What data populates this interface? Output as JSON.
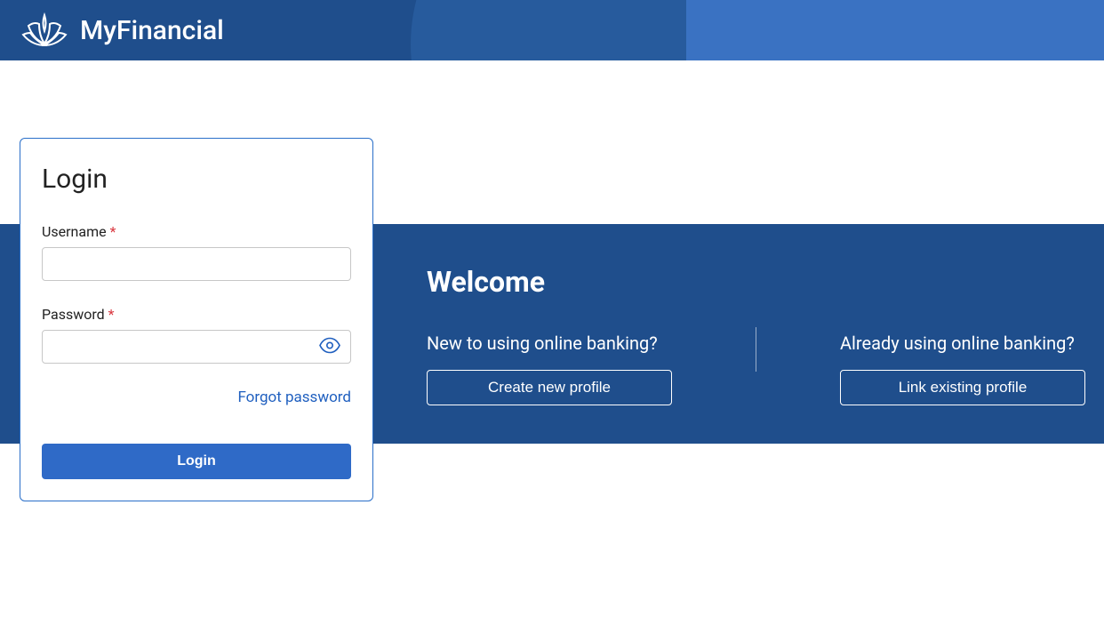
{
  "brand": {
    "name": "MyFinancial"
  },
  "login": {
    "title": "Login",
    "username_label": "Username",
    "password_label": "Password",
    "required_mark": "*",
    "username_value": "",
    "password_value": "",
    "forgot_link": "Forgot password",
    "submit_label": "Login"
  },
  "welcome": {
    "title": "Welcome",
    "new_question": "New to using online banking?",
    "new_button": "Create new profile",
    "existing_question": "Already using online banking?",
    "existing_button": "Link existing profile"
  }
}
